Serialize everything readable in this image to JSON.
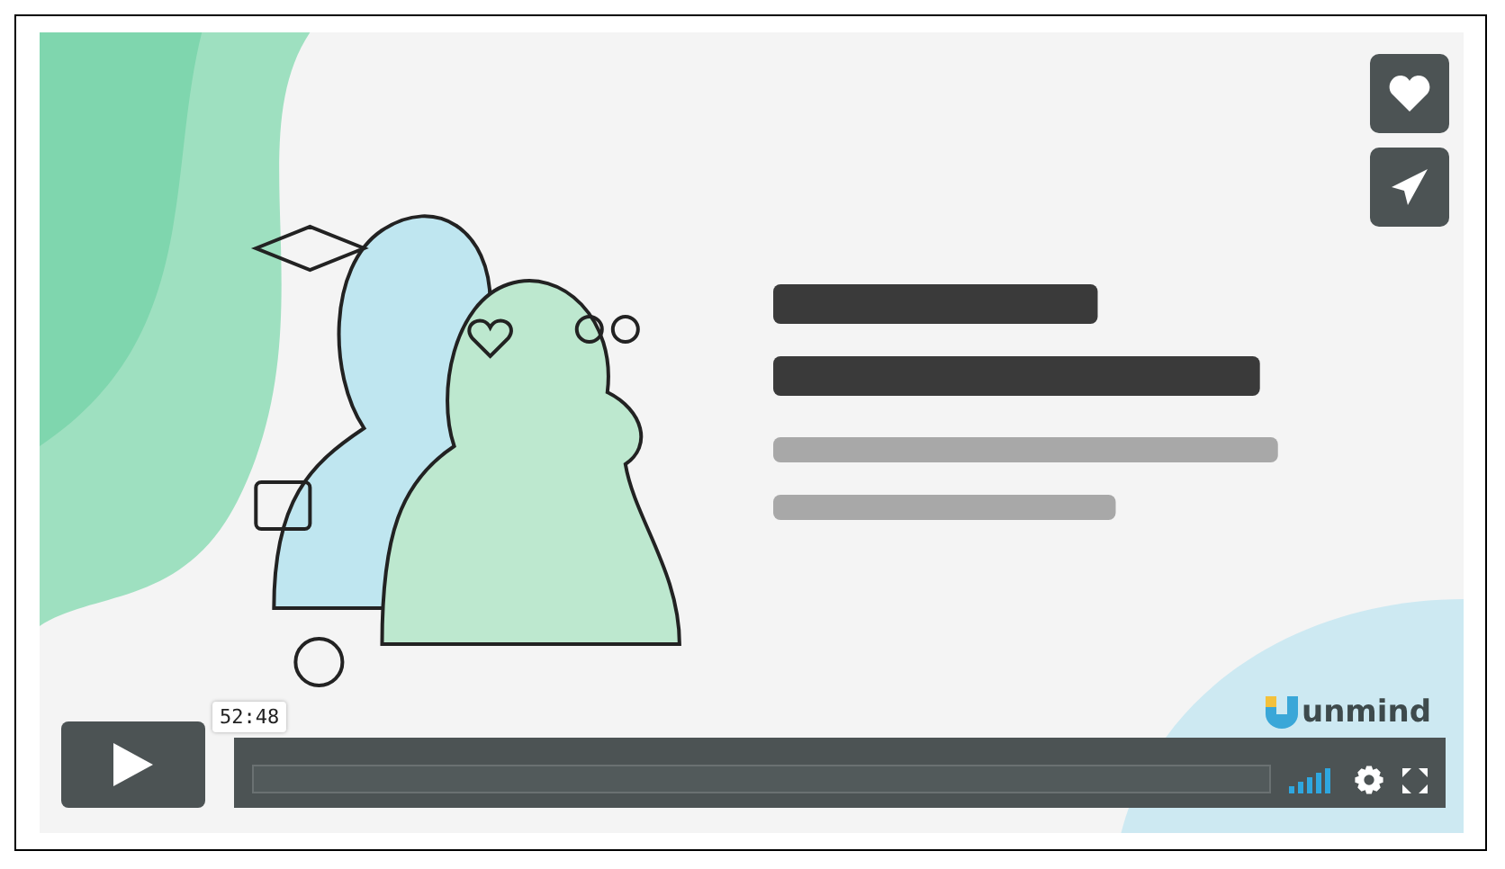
{
  "side_buttons": [
    {
      "kind": "like"
    },
    {
      "kind": "share"
    }
  ],
  "controls": {
    "time_tooltip": "52:48",
    "brand": "unmind",
    "progress": {
      "level": 0
    }
  }
}
